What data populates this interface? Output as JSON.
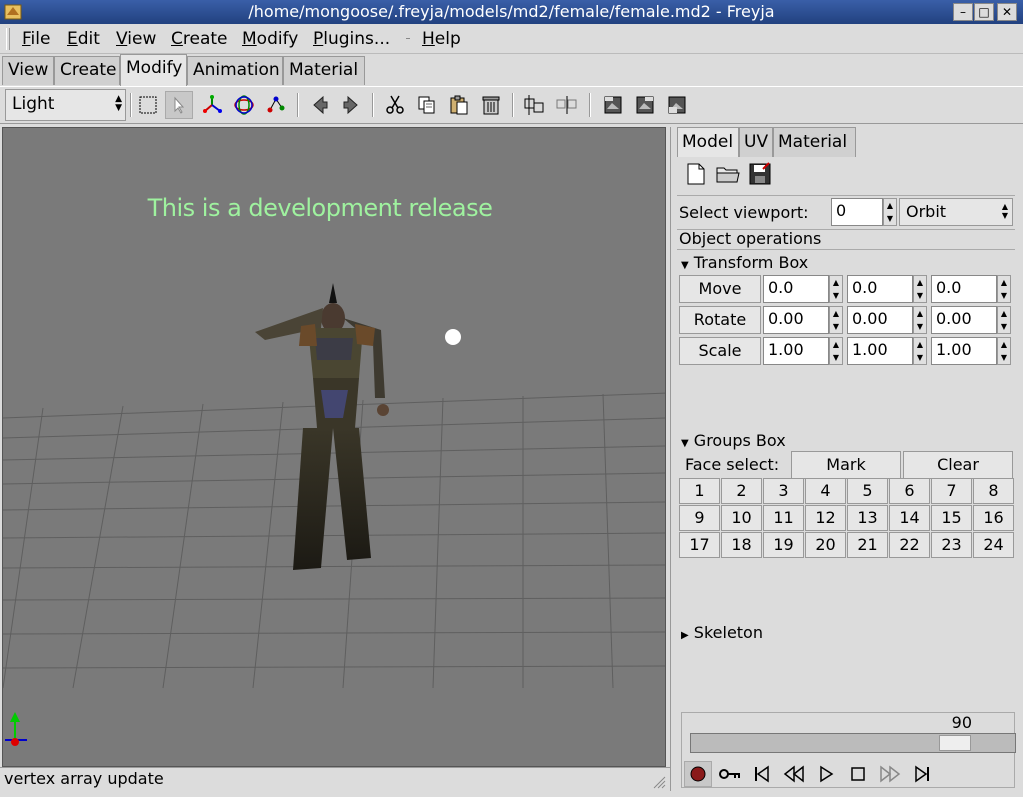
{
  "window": {
    "title": "/home/mongoose/.freyja/models/md2/female/female.md2 - Freyja",
    "minimize": "–",
    "maximize": "□",
    "close": "✕"
  },
  "menubar": {
    "items": [
      {
        "u": "F",
        "rest": "ile"
      },
      {
        "u": "E",
        "rest": "dit"
      },
      {
        "u": "V",
        "rest": "iew"
      },
      {
        "u": "C",
        "rest": "reate"
      },
      {
        "u": "M",
        "rest": "odify"
      },
      {
        "u": "P",
        "rest": "lugins..."
      },
      {
        "u": "H",
        "rest": "elp"
      }
    ]
  },
  "mode_tabs": [
    "View",
    "Create",
    "Modify",
    "Animation",
    "Material"
  ],
  "mode_tabs_active": "Modify",
  "toolbar": {
    "light_select": "Light",
    "icons": [
      "select-rect-icon",
      "pointer-icon",
      "axes-icon",
      "orbit-icon",
      "vertices-icon",
      "prev-icon",
      "next-icon",
      "cut-icon",
      "copy-icon",
      "paste-icon",
      "trash-icon",
      "grid-split-icon",
      "grid-merge-icon",
      "frame-icon-1",
      "frame-icon-2",
      "frame-icon-3"
    ]
  },
  "viewport": {
    "message": "This is a development release"
  },
  "status": {
    "text": "vertex array update"
  },
  "panel": {
    "tabs": [
      "Model",
      "UV",
      "Material"
    ],
    "active_tab": "Model",
    "select_viewport_label": "Select viewport:",
    "viewport_value": "0",
    "viewport_mode": "Orbit",
    "object_ops_label": "Object operations",
    "transform": {
      "title": "Transform Box",
      "rows": [
        {
          "label": "Move",
          "values": [
            "0.0",
            "0.0",
            "0.0"
          ]
        },
        {
          "label": "Rotate",
          "values": [
            "0.00",
            "0.00",
            "0.00"
          ]
        },
        {
          "label": "Scale",
          "values": [
            "1.00",
            "1.00",
            "1.00"
          ]
        }
      ]
    },
    "groups": {
      "title": "Groups Box",
      "face_select_label": "Face select:",
      "mark": "Mark",
      "clear": "Clear",
      "numbers": [
        "1",
        "2",
        "3",
        "4",
        "5",
        "6",
        "7",
        "8",
        "9",
        "10",
        "11",
        "12",
        "13",
        "14",
        "15",
        "16",
        "17",
        "18",
        "19",
        "20",
        "21",
        "22",
        "23",
        "24"
      ]
    },
    "skeleton": {
      "title": "Skeleton"
    }
  },
  "timeline": {
    "frame": "90",
    "slider_position": 0.85
  },
  "colors": {
    "viewport_bg": "#7a7a7a",
    "dev_text": "#9ff29f",
    "titlebar": "#2c4c90"
  }
}
